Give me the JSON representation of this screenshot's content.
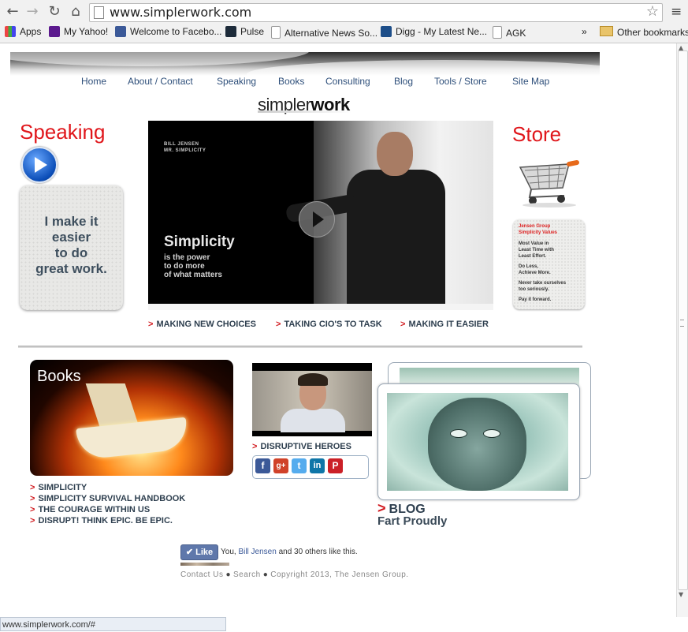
{
  "browser": {
    "url": "www.simplerwork.com",
    "bookmarks": [
      {
        "label": "Apps",
        "icon": "apps-grid-icon",
        "color": "#e44"
      },
      {
        "label": "My Yahoo!",
        "icon": "yahoo-icon",
        "color": "#5c1a8e"
      },
      {
        "label": "Welcome to Facebo...",
        "icon": "facebook-icon",
        "color": "#3b5998"
      },
      {
        "label": "Pulse",
        "icon": "pulse-icon",
        "color": "#1d2b3a"
      },
      {
        "label": "Alternative News So...",
        "icon": "page-icon",
        "color": "#ffffff"
      },
      {
        "label": "Digg - My Latest Ne...",
        "icon": "digg-icon",
        "color": "#1d4e89"
      },
      {
        "label": "AGK",
        "icon": "page-icon",
        "color": "#ffffff"
      }
    ],
    "overflow_label": "»",
    "other_bookmarks": "Other bookmarks",
    "status_url": "www.simplerwork.com/#"
  },
  "nav": [
    "Home",
    "About / Contact",
    "Speaking",
    "Books",
    "Consulting",
    "Blog",
    "Tools / Store",
    "Site Map"
  ],
  "brand": {
    "light": "simpler",
    "bold": "work"
  },
  "speaking": {
    "title": "Speaking",
    "card_text": [
      "I make it",
      "easier",
      "to do",
      "great work."
    ]
  },
  "video": {
    "name_line1": "BILL JENSEN",
    "name_line2": "MR. SIMPLICITY",
    "headline": "Simplicity",
    "subline": [
      "is the power",
      "to do more",
      "of what matters"
    ],
    "links": [
      "MAKING NEW CHOICES",
      "TAKING CIO'S TO TASK",
      "MAKING IT EASIER"
    ]
  },
  "store": {
    "title": "Store",
    "values_heading": [
      "Jensen Group",
      "Simplicity Values"
    ],
    "values": [
      "Most Value in",
      "Least Time with",
      "Least Effort.",
      "",
      "Do Less,",
      "Achieve More.",
      "",
      "Never take ourselves",
      "too seriously.",
      "",
      "Pay it forward."
    ]
  },
  "books": {
    "title": "Books",
    "links": [
      "SIMPLICITY",
      "SIMPLICITY SURVIVAL HANDBOOK",
      "THE COURAGE WITHIN US",
      "DISRUPT! THINK EPIC. BE EPIC."
    ]
  },
  "heroes": {
    "link": "DISRUPTIVE HEROES",
    "social": [
      {
        "label": "f",
        "icon": "facebook-icon",
        "color": "#3b5998"
      },
      {
        "label": "g+",
        "icon": "google-plus-icon",
        "color": "#d0422a"
      },
      {
        "label": "t",
        "icon": "twitter-icon",
        "color": "#55acee"
      },
      {
        "label": "in",
        "icon": "linkedin-icon",
        "color": "#0e76a8"
      },
      {
        "label": "P",
        "icon": "pinterest-icon",
        "color": "#cb2027"
      }
    ]
  },
  "blog": {
    "link": "BLOG",
    "subtitle": "Fart Proudly"
  },
  "like": {
    "button": "Like",
    "prefix": "You, ",
    "name": "Bill Jensen",
    "suffix": " and 30 others like this."
  },
  "footer": {
    "contact": "Contact Us",
    "search": "Search",
    "copyright": "Copyright 2013, The Jensen Group."
  },
  "colors": {
    "accent_red": "#e0161b",
    "link_dark": "#2e3f4f",
    "nav_blue": "#2e4f7a"
  }
}
